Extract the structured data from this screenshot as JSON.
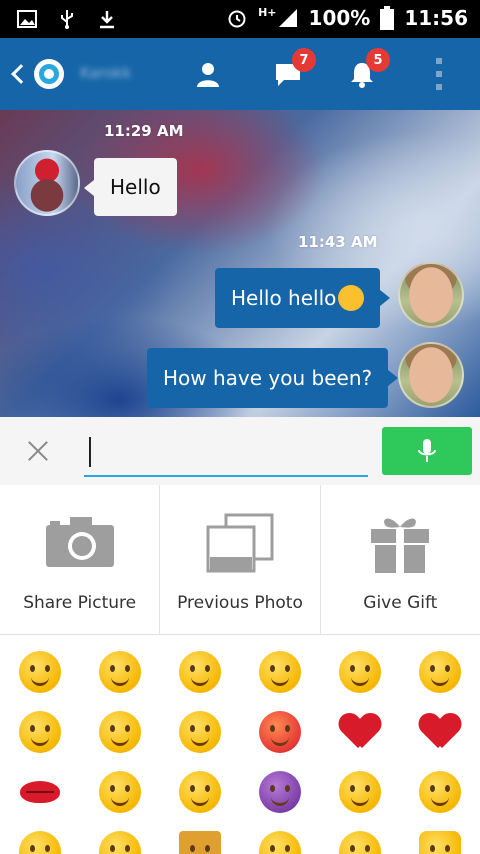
{
  "status_bar": {
    "battery": "100%",
    "time": "11:56",
    "network": "H+"
  },
  "app_bar": {
    "contact_name": "Karokk",
    "messages_badge": "7",
    "notifications_badge": "5"
  },
  "chat": {
    "messages": [
      {
        "timestamp": "11:29 AM",
        "text": "Hello",
        "direction": "incoming"
      },
      {
        "timestamp": "11:43 AM",
        "text": "Hello hello",
        "direction": "outgoing",
        "emoji": "grinning-face"
      },
      {
        "timestamp": "",
        "text": "How have you been?",
        "direction": "outgoing"
      }
    ]
  },
  "input": {
    "value": "",
    "placeholder": ""
  },
  "actions": [
    {
      "label": "Share Picture",
      "icon": "camera-icon"
    },
    {
      "label": "Previous Photo",
      "icon": "photo-stack-icon"
    },
    {
      "label": "Give Gift",
      "icon": "gift-icon"
    }
  ],
  "emoji_palette": [
    "grinning-face",
    "smiley-face",
    "disappointed-face",
    "crying-face",
    "winking-face",
    "squinting-tongue-face",
    "winking-tongue-face",
    "kissing-face",
    "dizzy-face",
    "angry-face",
    "red-heart",
    "broken-heart",
    "kiss-lips",
    "relieved-face",
    "grimacing-face",
    "imp-face",
    "heart-eyes-face",
    "blush-face",
    "sweat-face",
    "kissing-face-2",
    "beer-mug",
    "grinning-face-2",
    "grinning-face-3",
    "thumbs-up"
  ],
  "colors": {
    "app_bar": "#1565a8",
    "outgoing_bubble": "#1565a8",
    "incoming_bubble": "#f4f4f4",
    "mic_button": "#2ec95a",
    "badge": "#e53935"
  }
}
